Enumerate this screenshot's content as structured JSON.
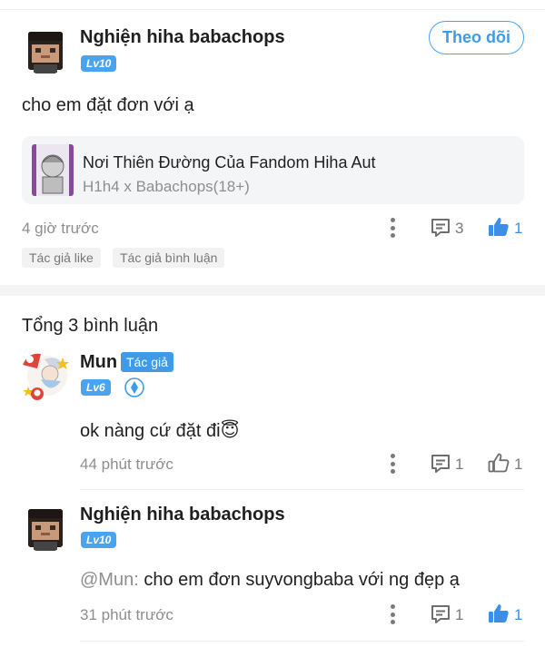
{
  "post": {
    "author": {
      "name": "Nghiện hiha babachops",
      "level": "Lv10"
    },
    "follow_label": "Theo dõi",
    "text": "cho em đặt đơn với ạ",
    "linked": {
      "title": "Nơi Thiên Đường Của Fandom Hiha Aut",
      "subtitle": "H1h4 x Babachops(18+)"
    },
    "time": "4 giờ trước",
    "comment_count": "3",
    "like_count": "1",
    "liked": true,
    "tags": [
      "Tác giả like",
      "Tác giả bình luận"
    ]
  },
  "comments_total": "Tổng 3 bình luận",
  "comments": [
    {
      "author": "Mun",
      "badge": "Tác giả",
      "level": "Lv6",
      "text": "ok nàng cứ đặt đi😇",
      "time": "44 phút trước",
      "reply_count": "1",
      "like_count": "1",
      "liked": false
    },
    {
      "author": "Nghiện hiha babachops",
      "level": "Lv10",
      "mention": "@Mun:",
      "text": " cho em đơn suyvongbaba với ng đẹp ạ",
      "time": "31 phút trước",
      "reply_count": "1",
      "like_count": "1",
      "liked": true
    }
  ],
  "colors": {
    "accent": "#3d9be9",
    "muted": "#8e8e8e"
  }
}
